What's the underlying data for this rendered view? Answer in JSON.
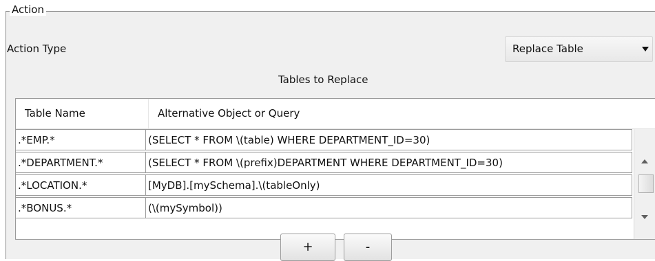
{
  "group": {
    "title": "Action"
  },
  "action_type": {
    "label": "Action Type",
    "selected": "Replace Table",
    "arrow_icon": "chevron-down-icon"
  },
  "tables": {
    "caption": "Tables to Replace",
    "headers": [
      "Table Name",
      "Alternative Object or Query"
    ],
    "rows": [
      [
        ".*EMP.*",
        "(SELECT * FROM \\(table) WHERE DEPARTMENT_ID=30)"
      ],
      [
        ".*DEPARTMENT.*",
        "(SELECT * FROM \\(prefix)DEPARTMENT WHERE DEPARTMENT_ID=30)"
      ],
      [
        ".*LOCATION.*",
        "[MyDB].[mySchema].\\(tableOnly)"
      ],
      [
        ".*BONUS.*",
        "(\\(mySymbol))"
      ]
    ]
  },
  "buttons": {
    "add_label": "+",
    "remove_label": "-"
  }
}
